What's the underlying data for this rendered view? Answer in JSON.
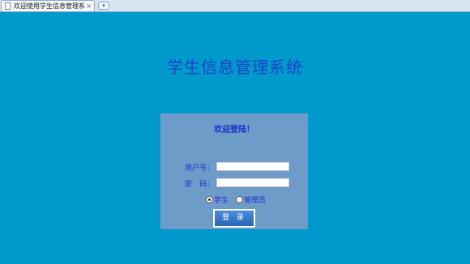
{
  "browser": {
    "tab_title": "欢迎使用学生信息管理系统",
    "tab_close": "×",
    "new_tab": "▾"
  },
  "page": {
    "system_title": "学生信息管理系统",
    "login": {
      "welcome": "欢迎登陆！",
      "username_label": "用户号：",
      "password_label": "密　码：",
      "username_value": "",
      "password_value": "",
      "roles": [
        {
          "label": "学生",
          "checked": true
        },
        {
          "label": "管理员",
          "checked": false
        }
      ],
      "submit_label": "登 录"
    }
  },
  "colors": {
    "background": "#0099cc",
    "panel": "#6d9cc9",
    "text_accent": "#1a2fd0",
    "title": "#1a44c8"
  }
}
